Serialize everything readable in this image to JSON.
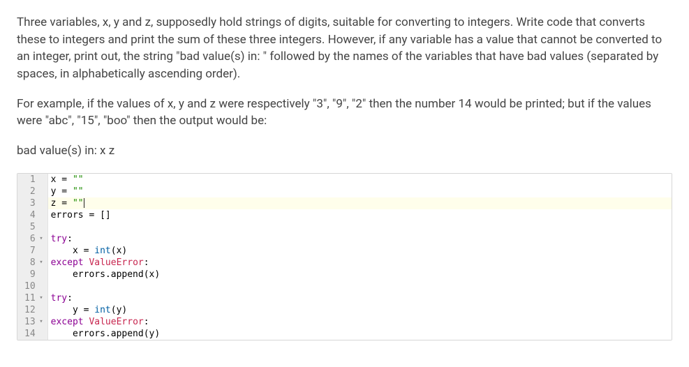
{
  "problem": {
    "p1": "Three variables, x, y and z, supposedly hold strings of digits, suitable for converting to integers. Write code that converts these to integers and print the sum of these three integers. However, if any variable has a value that cannot be converted to an integer, print out, the string \"bad value(s) in: \" followed by the names of the variables that have bad values (separated by spaces, in alphabetically ascending order).",
    "p2": "For example, if the values of x, y and z were respectively \"3\", \"9\", \"2\" then the number 14 would be printed; but if the values were \"abc\", \"15\", \"boo\" then the output would be:",
    "p3": "bad value(s) in: x z"
  },
  "editor": {
    "lines": [
      {
        "n": "1",
        "fold": false,
        "active": false,
        "tokens": [
          [
            "",
            "x = "
          ],
          [
            "str",
            "\"\""
          ]
        ]
      },
      {
        "n": "2",
        "fold": false,
        "active": false,
        "tokens": [
          [
            "",
            "y = "
          ],
          [
            "str",
            "\"\""
          ]
        ]
      },
      {
        "n": "3",
        "fold": false,
        "active": true,
        "tokens": [
          [
            "",
            "z = "
          ],
          [
            "str",
            "\"\""
          ]
        ],
        "cursor": true
      },
      {
        "n": "4",
        "fold": false,
        "active": false,
        "tokens": [
          [
            "",
            "errors = []"
          ]
        ]
      },
      {
        "n": "5",
        "fold": false,
        "active": false,
        "tokens": [
          [
            "",
            ""
          ]
        ]
      },
      {
        "n": "6",
        "fold": true,
        "active": false,
        "tokens": [
          [
            "kw",
            "try"
          ],
          [
            "",
            ":"
          ]
        ]
      },
      {
        "n": "7",
        "fold": false,
        "active": false,
        "tokens": [
          [
            "",
            "    x = "
          ],
          [
            "fn",
            "int"
          ],
          [
            "",
            "(x)"
          ]
        ]
      },
      {
        "n": "8",
        "fold": true,
        "active": false,
        "tokens": [
          [
            "kw",
            "except"
          ],
          [
            "",
            " "
          ],
          [
            "err",
            "ValueError"
          ],
          [
            "",
            ":"
          ]
        ]
      },
      {
        "n": "9",
        "fold": false,
        "active": false,
        "tokens": [
          [
            "",
            "    errors.append(x)"
          ]
        ]
      },
      {
        "n": "10",
        "fold": false,
        "active": false,
        "tokens": [
          [
            "",
            ""
          ]
        ]
      },
      {
        "n": "11",
        "fold": true,
        "active": false,
        "tokens": [
          [
            "kw",
            "try"
          ],
          [
            "",
            ":"
          ]
        ]
      },
      {
        "n": "12",
        "fold": false,
        "active": false,
        "tokens": [
          [
            "",
            "    y = "
          ],
          [
            "fn",
            "int"
          ],
          [
            "",
            "(y)"
          ]
        ]
      },
      {
        "n": "13",
        "fold": true,
        "active": false,
        "tokens": [
          [
            "kw",
            "except"
          ],
          [
            "",
            " "
          ],
          [
            "err",
            "ValueError"
          ],
          [
            "",
            ":"
          ]
        ]
      },
      {
        "n": "14",
        "fold": false,
        "active": false,
        "tokens": [
          [
            "",
            "    errors.append(y)"
          ]
        ]
      }
    ]
  }
}
